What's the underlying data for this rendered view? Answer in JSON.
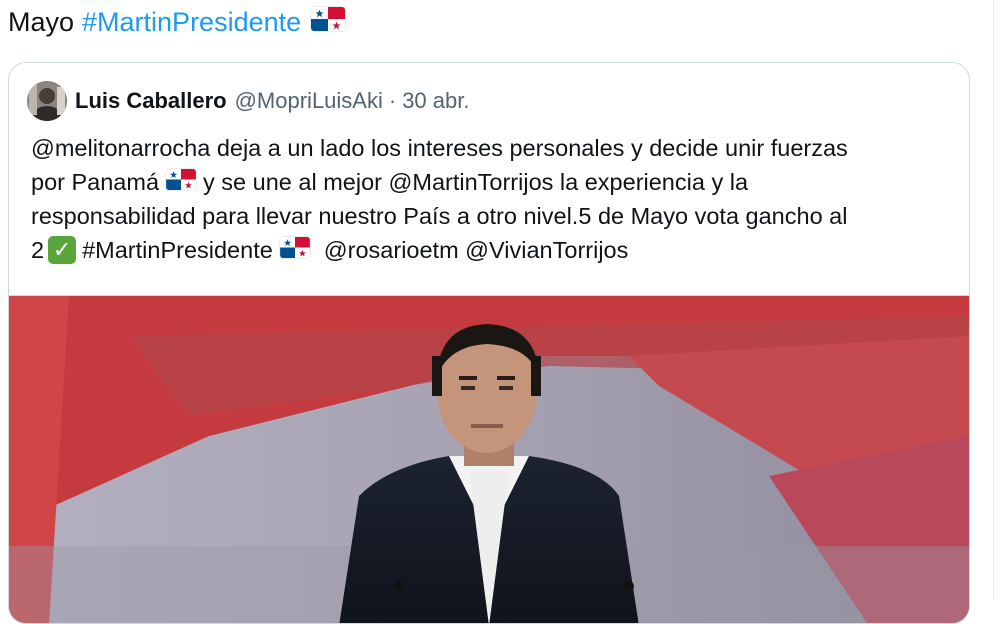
{
  "tweet": {
    "text_prefix": "Mayo",
    "hashtag": "#MartinPresidente",
    "flag_icon": "panama-flag-icon"
  },
  "quoted_tweet": {
    "author_name": "Luis Caballero",
    "author_handle": "@MopriLuisAki",
    "separator": "·",
    "date": "30 abr.",
    "text_lines": {
      "line1": "@melitonarrocha deja a un lado los intereses personales y decide unir fuerzas",
      "line2_a": "por Panamá",
      "line2_b": "y se une al mejor @MartinTorrijos la experiencia y la",
      "line3": "responsabilidad para llevar nuestro País a otro nivel.5 de Mayo vota gancho al",
      "line4_a": "2",
      "line4_b": "#MartinPresidente",
      "line4_c": "@rosarioetm @VivianTorrijos"
    },
    "check_icon": "white-heavy-check-mark-icon",
    "media": {
      "type": "video-thumbnail"
    }
  },
  "colors": {
    "hashtag": "#1d9bf0",
    "text": "#0f1419",
    "muted": "#536471",
    "border": "#cfd9de"
  }
}
